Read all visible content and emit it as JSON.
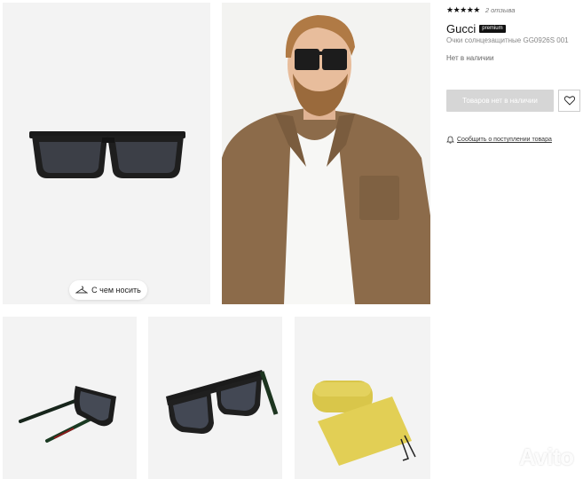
{
  "product": {
    "rating_stars": "★★★★★",
    "reviews": "2 отзыва",
    "brand": "Gucci",
    "badge": "premium",
    "name": "Очки солнцезащитные GG0926S 001",
    "availability": "Нет в наличии",
    "buy_button": "Товаров нет в наличии",
    "notify_link": "Сообщить о поступлении товара"
  },
  "gallery": {
    "wear_chip": "С чем носить"
  },
  "watermark": {
    "text": "Avito"
  },
  "icons": {
    "fav": "heart-icon",
    "notify": "bell-icon",
    "wear": "hanger-icon"
  },
  "colors": {
    "button_disabled": "#d6d6d6",
    "badge": "#111111"
  }
}
